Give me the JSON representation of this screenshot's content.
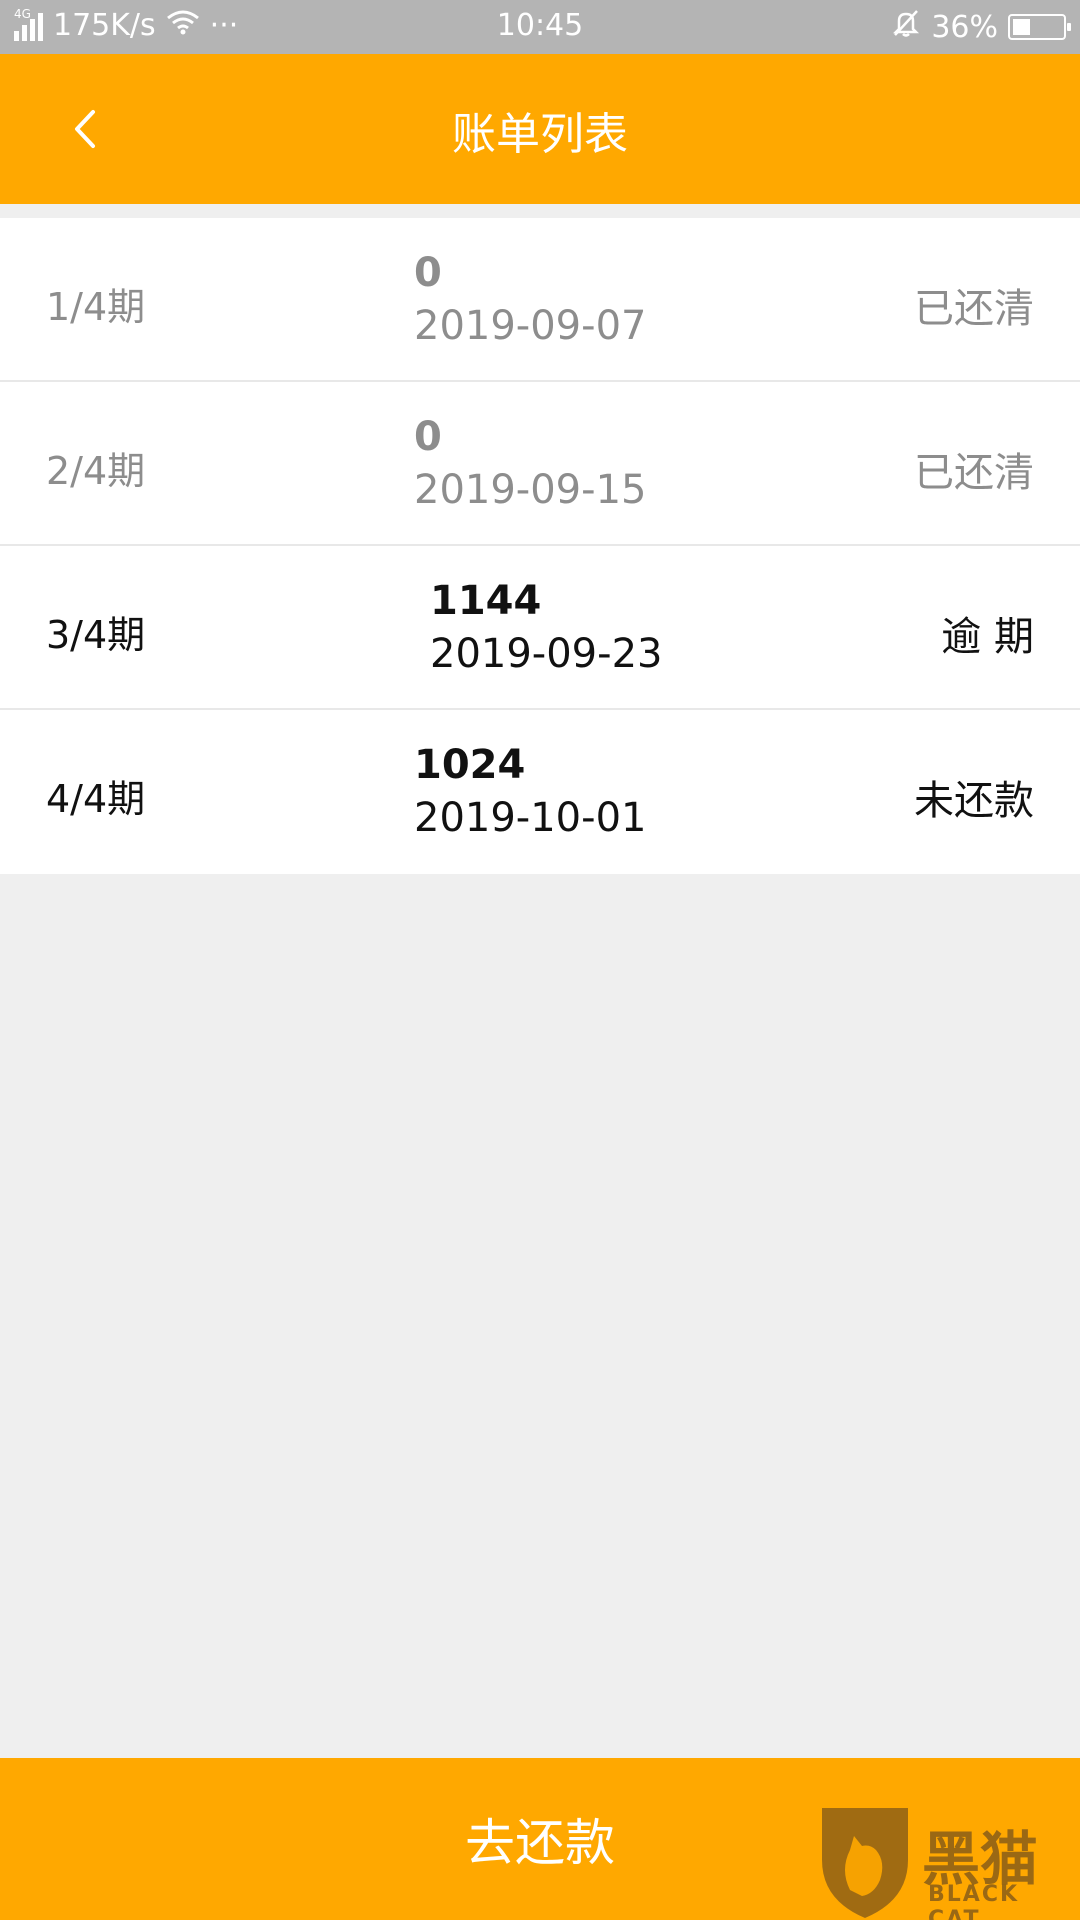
{
  "status_bar": {
    "network": "4G",
    "speed": "175K/s",
    "more": "···",
    "time": "10:45",
    "battery": "36%",
    "battery_level": 0.36
  },
  "header": {
    "title": "账单列表"
  },
  "bills": [
    {
      "period": "1/4期",
      "amount": "0",
      "date": "2019-09-07",
      "status": "已还清"
    },
    {
      "period": "2/4期",
      "amount": "0",
      "date": "2019-09-15",
      "status": "已还清"
    },
    {
      "period": "3/4期",
      "amount": "1144",
      "date": "2019-09-23",
      "status": "逾 期"
    },
    {
      "period": "4/4期",
      "amount": "1024",
      "date": "2019-10-01",
      "status": "未还款"
    }
  ],
  "pay_button": {
    "label": "去还款"
  },
  "watermark": {
    "text": "黑猫",
    "sub": "BLACK CAT"
  },
  "colors": {
    "accent": "#ffa800",
    "paid_text": "#8d8d8d",
    "unpaid_text": "#111111"
  }
}
